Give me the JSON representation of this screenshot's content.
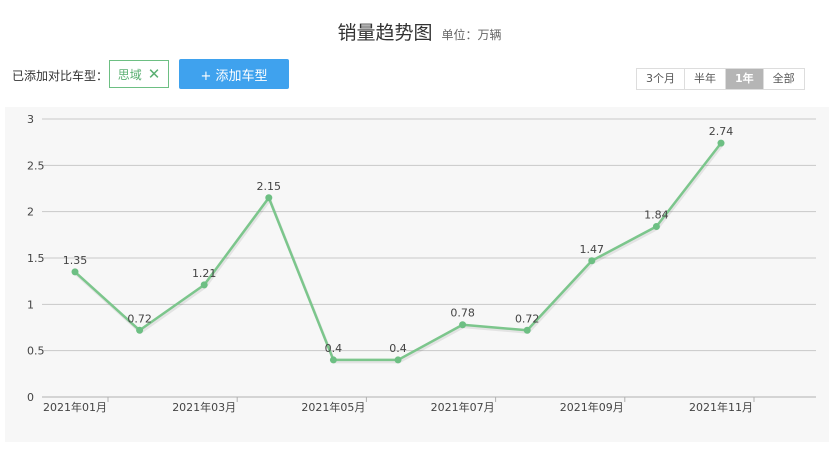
{
  "header": {
    "title": "销量趋势图",
    "unit": "单位：万辆"
  },
  "compare": {
    "label": "已添加对比车型：",
    "tag": "思域",
    "add_button": "+ 添加车型"
  },
  "range": {
    "options": [
      "3个月",
      "半年",
      "1年",
      "全部"
    ],
    "selected": "1年"
  },
  "colors": {
    "line": "#7cc68c",
    "point": "#6dbf83",
    "accent": "#3fa2ee"
  },
  "chart_data": {
    "type": "line",
    "series": [
      {
        "values": [
          1.35,
          0.72,
          1.21,
          2.15,
          0.4,
          0.4,
          0.78,
          0.72,
          1.47,
          1.84,
          2.74
        ],
        "labels": [
          "1.35",
          "0.72",
          "1.21",
          "2.15",
          "0.4",
          "0.4",
          "0.78",
          "0.72",
          "1.47",
          "1.84",
          "2.74"
        ]
      }
    ],
    "x_tick_labels": [
      "2021年01月",
      "2021年03月",
      "2021年05月",
      "2021年07月",
      "2021年09月",
      "2021年11月"
    ],
    "y_ticks": [
      0,
      0.5,
      1,
      1.5,
      2,
      2.5,
      3
    ],
    "y_tick_labels": [
      "0",
      "0.5",
      "1",
      "1.5",
      "2",
      "2.5",
      "3"
    ],
    "ylim": [
      0,
      3
    ],
    "grid": true
  }
}
